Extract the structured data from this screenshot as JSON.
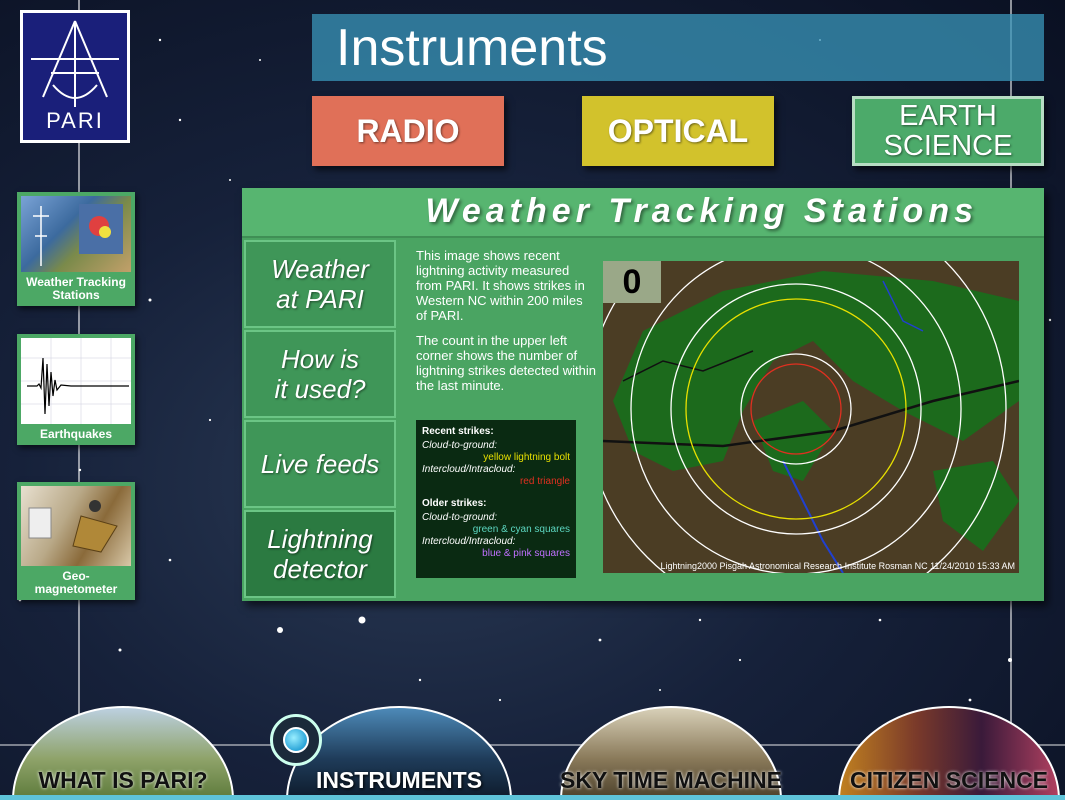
{
  "logo": {
    "text": "PARI"
  },
  "header": {
    "title": "Instruments"
  },
  "categories": [
    {
      "label": "RADIO",
      "color": "#e07058"
    },
    {
      "label": "OPTICAL",
      "color": "#d2c22c"
    },
    {
      "label_line1": "EARTH",
      "label_line2": "SCIENCE",
      "color": "#4caa6a"
    }
  ],
  "sidebar": {
    "items": [
      {
        "label": "Weather Tracking Stations"
      },
      {
        "label": "Earthquakes"
      },
      {
        "label": "Geo-magnetometer"
      }
    ]
  },
  "panel": {
    "title": "Weather Tracking Stations",
    "tabs": [
      {
        "line1": "Weather",
        "line2": "at PARI"
      },
      {
        "line1": "How is",
        "line2": "it used?"
      },
      {
        "line1": "Live feeds",
        "line2": ""
      },
      {
        "line1": "Lightning",
        "line2": "detector"
      }
    ],
    "description": [
      "This image shows recent lightning activity measured from PARI.  It shows strikes in Western NC within 200 miles of PARI.",
      "The count in the upper left corner shows the number of lightning strikes detected within the last minute."
    ],
    "legend": {
      "recent_heading": "Recent strikes:",
      "recent_cg_label": "Cloud-to-ground:",
      "recent_cg_value": "yellow lightning bolt",
      "recent_ic_label": "Intercloud/Intracloud:",
      "recent_ic_value": "red triangle",
      "older_heading": "Older strikes:",
      "older_cg_label": "Cloud-to-ground:",
      "older_cg_value": "green & cyan squares",
      "older_ic_label": "Intercloud/Intracloud:",
      "older_ic_value": "blue & pink squares",
      "colors": {
        "yellow": "#e8e000",
        "red": "#e03020",
        "green": "#5cd65c",
        "cyan": "#40e0e0",
        "blue": "#6080ff",
        "pink": "#ff60c0"
      }
    },
    "map": {
      "count": "0",
      "credit": "Lightning2000 Pisgah Astronomical Research Institute  Rosman NC  11/24/2010 15:33 AM"
    }
  },
  "bottom_nav": [
    {
      "label": "WHAT IS PARI?"
    },
    {
      "label": "INSTRUMENTS"
    },
    {
      "label": "SKY TIME MACHINE"
    },
    {
      "label": "CITIZEN SCIENCE"
    }
  ]
}
